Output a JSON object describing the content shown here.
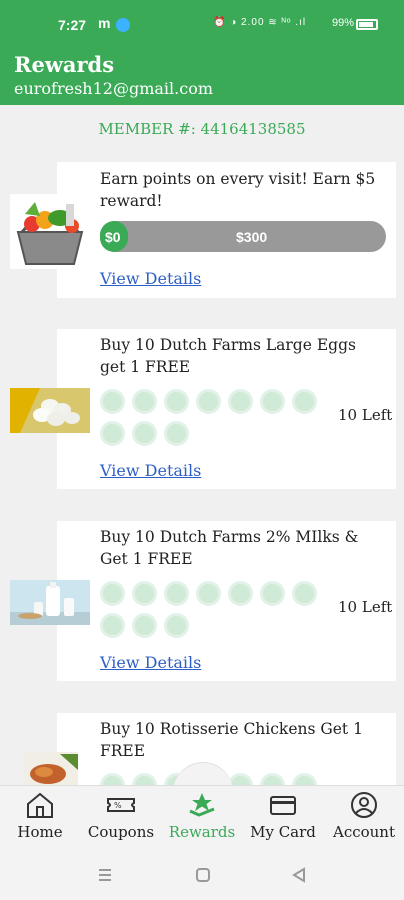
{
  "status": {
    "time": "7:27",
    "m": "m",
    "icons": "⏰ ◑ 2.00 ≋ ᴺᵒ .ıl",
    "battery": "99%"
  },
  "header": {
    "title": "Rewards",
    "email": "eurofresh12@gmail.com"
  },
  "member": "MEMBER #: 44164138585",
  "cards": [
    {
      "title": "Earn points on every visit! Earn $5 reward!",
      "progress": {
        "start": "$0",
        "goal": "$300",
        "fraction": 0.08
      },
      "link": "View Details"
    },
    {
      "title": "Buy 10 Dutch Farms Large Eggs get 1 FREE",
      "left": "10 Left",
      "link": "View Details"
    },
    {
      "title": "Buy 10 Dutch Farms 2% MIlks & Get 1 FREE",
      "left": "10 Left",
      "link": "View Details"
    },
    {
      "title": "Buy 10 Rotisserie Chickens Get 1 FREE"
    }
  ],
  "nav": {
    "home": "Home",
    "coupons": "Coupons",
    "rewards": "Rewards",
    "mycard": "My Card",
    "account": "Account"
  },
  "colors": {
    "brand": "#3aaa57",
    "link": "#2c5fc7",
    "progress_track": "#999999"
  }
}
